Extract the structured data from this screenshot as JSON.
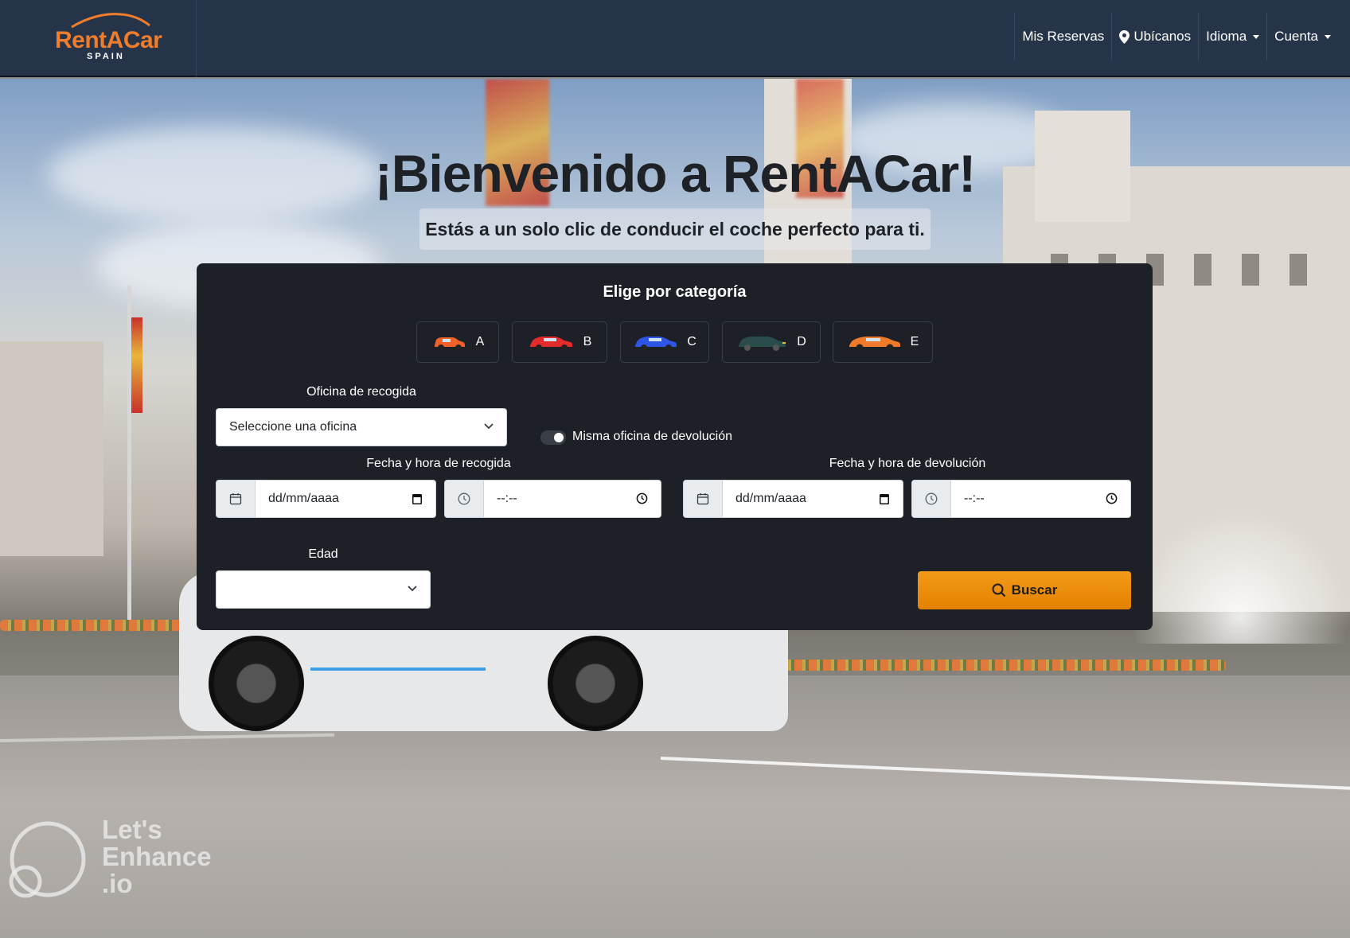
{
  "brand": {
    "name": "RentACar",
    "tagline": "SPAIN",
    "accent": "#ef7d2b",
    "navbar_bg": "#26344a"
  },
  "nav": {
    "items": [
      {
        "label": "Mis Reservas",
        "icon": ""
      },
      {
        "label": "Ubícanos",
        "icon": "map-marker-icon"
      },
      {
        "label": "Idioma",
        "icon": "caret-down-icon"
      },
      {
        "label": "Cuenta",
        "icon": "caret-down-icon"
      }
    ]
  },
  "hero": {
    "title": "¡Bienvenido a RentACar!",
    "subtitle": "Estás a un solo clic de conducir el coche perfecto para ti."
  },
  "search": {
    "title": "Elige por categoría",
    "categories": [
      {
        "label": "A",
        "color": "#f0622a"
      },
      {
        "label": "B",
        "color": "#e32b2b"
      },
      {
        "label": "C",
        "color": "#2d56e6"
      },
      {
        "label": "D",
        "color": "#2a4d4b"
      },
      {
        "label": "E",
        "color": "#f07a2a"
      }
    ],
    "pickup_office": {
      "label": "Oficina de recogida",
      "value": "Seleccione una oficina"
    },
    "same_office_toggle": {
      "label": "Misma oficina de devolución",
      "on": true
    },
    "pickup_datetime": {
      "label": "Fecha y hora de recogida",
      "date_placeholder": "dd/mm/aaaa",
      "time_placeholder": "--:--"
    },
    "return_datetime": {
      "label": "Fecha y hora de devolución",
      "date_placeholder": "dd/mm/aaaa",
      "time_placeholder": "--:--"
    },
    "age": {
      "label": "Edad",
      "value": ""
    },
    "submit": {
      "label": "Buscar",
      "color": "#f39a1a"
    }
  },
  "watermark": {
    "line1": "Let's",
    "line2": "Enhance",
    "line3": ".io"
  }
}
